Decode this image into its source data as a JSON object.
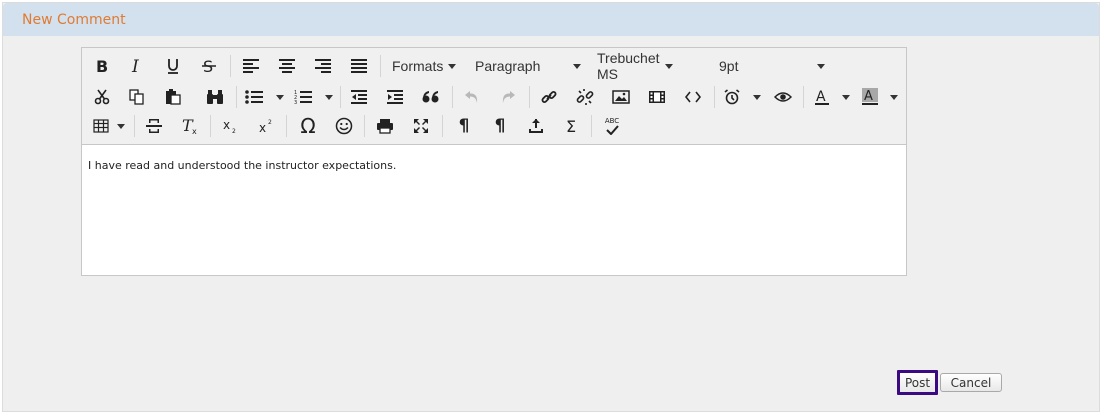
{
  "panel": {
    "title": "New Comment"
  },
  "toolbar": {
    "formats_label": "Formats",
    "block_format": "Paragraph",
    "font_family": "Trebuchet MS",
    "font_size": "9pt",
    "icons": {
      "omega": "Ω",
      "sigma": "Σ",
      "pilcrow": "¶",
      "spellcheck_text": "ABC"
    }
  },
  "editor": {
    "content": "I have read and understood the instructor expectations."
  },
  "buttons": {
    "post": "Post",
    "cancel": "Cancel"
  },
  "colors": {
    "title": "#e07b32",
    "header_bg": "#d3e1ee",
    "focus_outline": "#3b0a82"
  }
}
